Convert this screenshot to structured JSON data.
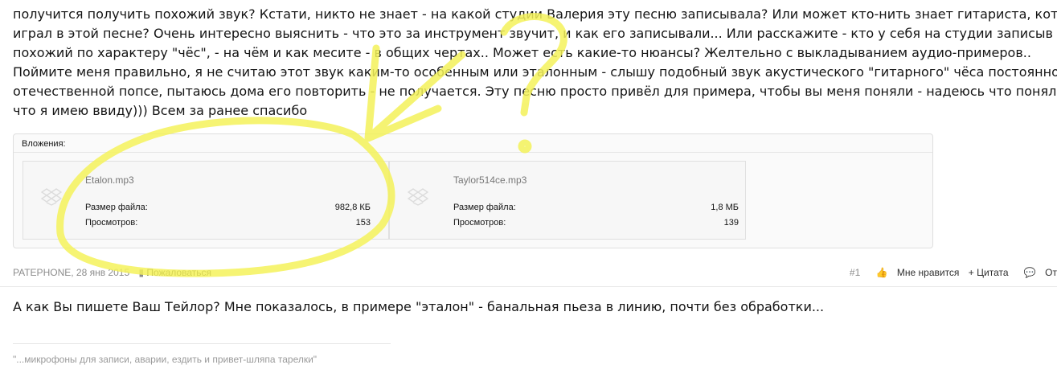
{
  "post": {
    "lines": [
      "получится получить похожий звук? Кстати, никто не знает - на какой студии Валерия эту песню записывала? Или может кто-нить знает гитариста, кот",
      "играл в этой песне? Очень интересно выяснить - что это за инструмент звучит, и как его записывали... Или расскажите - кто у себя на студии записыв",
      "похожий по характеру \"чёс\", - на чём и как месите - в общих чертах.. Может есть какие-то нюансы? Желтельно с выкладыванием аудио-примеров..",
      "Поймите меня правильно, я не считаю этот звук каким-то особенным или эталонным - слышу подобный звук акустического \"гитарного\" чёса постоянно",
      "отечественной попсе, пытаюсь дома его повторить - не получается. Эту песню просто привёл для примера, чтобы вы меня поняли - надеюсь что понял",
      "что я имею ввиду))) Всем за ранее спасибо"
    ]
  },
  "attachments": {
    "title": "Вложения:",
    "files": [
      {
        "name": "Etalon.mp3",
        "size_label": "Размер файла:",
        "size": "982,8 КБ",
        "views_label": "Просмотров:",
        "views": "153"
      },
      {
        "name": "Taylor514ce.mp3",
        "size_label": "Размер файла:",
        "size": "1,8 МБ",
        "views_label": "Просмотров:",
        "views": "139"
      }
    ]
  },
  "meta": {
    "author": "PATEPHONE",
    "date": "28 янв 2015",
    "report": "Пожаловаться",
    "post_number": "#1",
    "like": "Мне нравится",
    "quote": "+ Цитата",
    "reply": "От"
  },
  "reply": {
    "text": "А как Вы пишете Ваш Тейлор? Мне показалось, в примере \"эталон\" - банальная пьеза в линию, почти без обработки..."
  },
  "signature": {
    "text": "\"...микрофоны для записи, аварии, ездить и привет-шляпа тарелки\""
  },
  "colors": {
    "annotation": "#f4f25a",
    "muted": "#8c8c8c"
  }
}
